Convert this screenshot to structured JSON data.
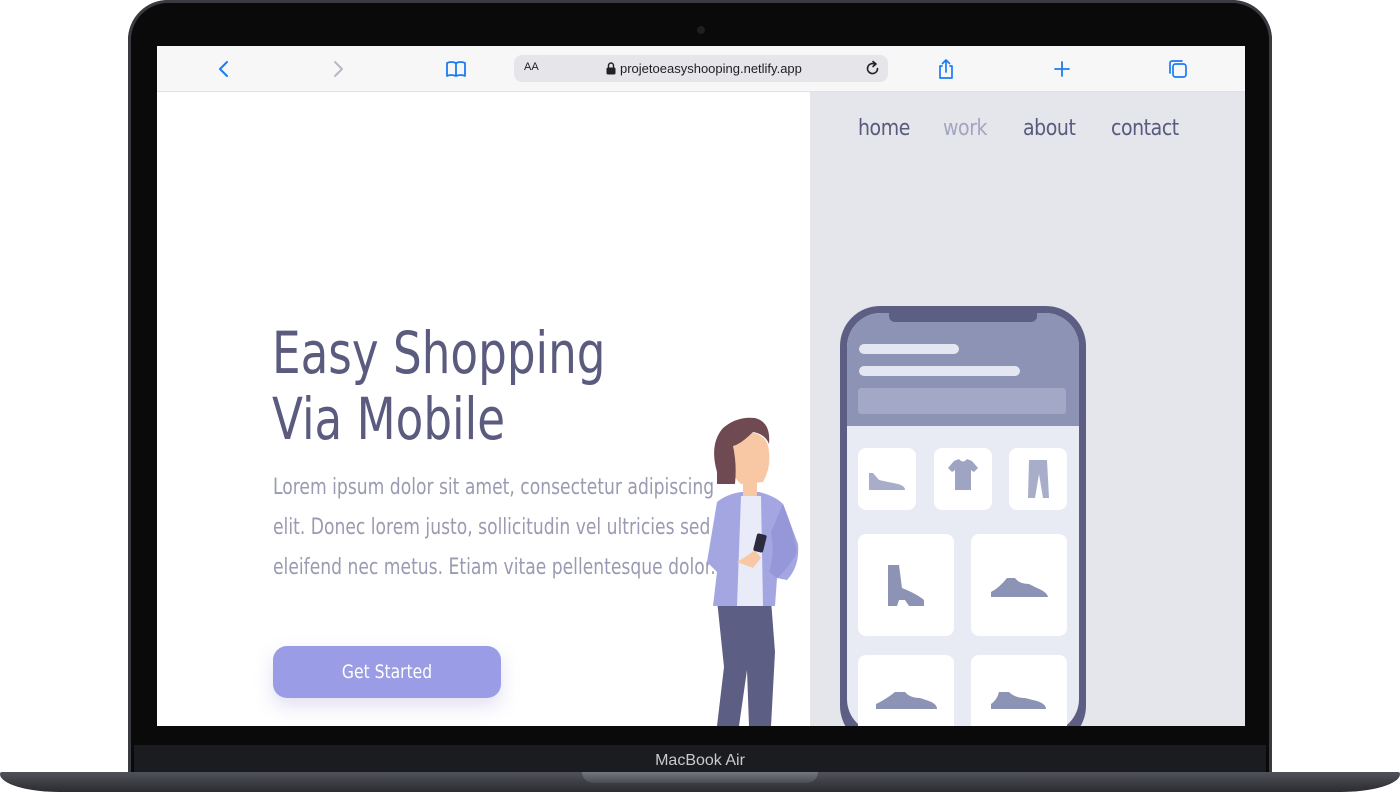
{
  "device": {
    "label": "MacBook Air"
  },
  "browser": {
    "text_size_label": "AA",
    "url": "projetoeasyshooping.netlify.app",
    "icons": [
      "back-icon",
      "forward-icon",
      "bookmarks-icon",
      "lock-icon",
      "reload-icon",
      "share-icon",
      "new-tab-icon",
      "tabs-icon"
    ],
    "accent_color": "#1a7cf2"
  },
  "nav": {
    "items": [
      {
        "label": "home"
      },
      {
        "label": "work"
      },
      {
        "label": "about"
      },
      {
        "label": "contact"
      }
    ]
  },
  "hero": {
    "title_line1": "Easy Shopping",
    "title_line2": "Via Mobile",
    "text_line1": "Lorem ipsum dolor sit amet, consectetur adipiscing",
    "text_line2": "elit. Donec lorem justo, sollicitudin vel ultricies sed,",
    "text_line3": "eleifend nec metus. Etiam vitae pellentesque dolor.",
    "cta_label": "Get Started"
  },
  "illustration": {
    "phone_products": [
      "sneaker-icon",
      "tshirt-icon",
      "pants-icon",
      "boot-icon",
      "shoe-icon",
      "shoe-icon",
      "shoe-icon"
    ]
  },
  "colors": {
    "primary_text": "#5a5b7e",
    "muted_text": "#9a9bb2",
    "button": "#9a9ce6",
    "panel": "#e5e5ec"
  }
}
